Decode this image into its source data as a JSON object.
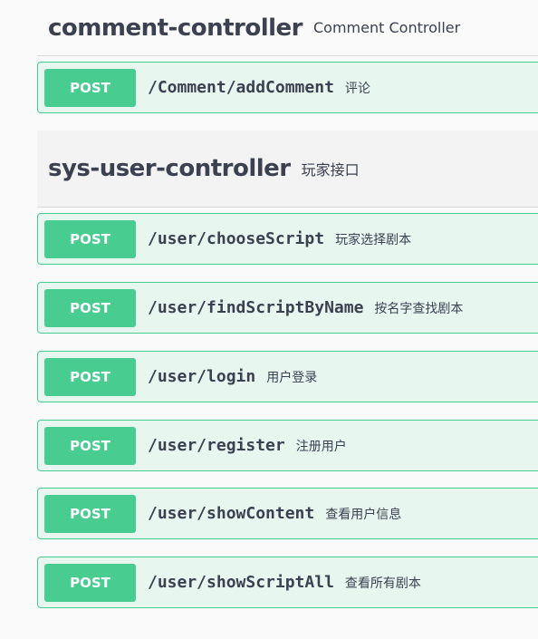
{
  "sections": [
    {
      "name": "comment-controller",
      "description": "Comment Controller",
      "operations": [
        {
          "method": "POST",
          "path": "/Comment/addComment",
          "summary": "评论"
        }
      ]
    },
    {
      "name": "sys-user-controller",
      "description": "玩家接口",
      "operations": [
        {
          "method": "POST",
          "path": "/user/chooseScript",
          "summary": "玩家选择剧本"
        },
        {
          "method": "POST",
          "path": "/user/findScriptByName",
          "summary": "按名字查找剧本"
        },
        {
          "method": "POST",
          "path": "/user/login",
          "summary": "用户登录"
        },
        {
          "method": "POST",
          "path": "/user/register",
          "summary": "注册用户"
        },
        {
          "method": "POST",
          "path": "/user/showContent",
          "summary": "查看用户信息"
        },
        {
          "method": "POST",
          "path": "/user/showScriptAll",
          "summary": "查看所有剧本"
        }
      ]
    }
  ],
  "colors": {
    "post_accent": "#49cc90",
    "post_background": "#e8f6f0",
    "text": "#3b4151"
  }
}
